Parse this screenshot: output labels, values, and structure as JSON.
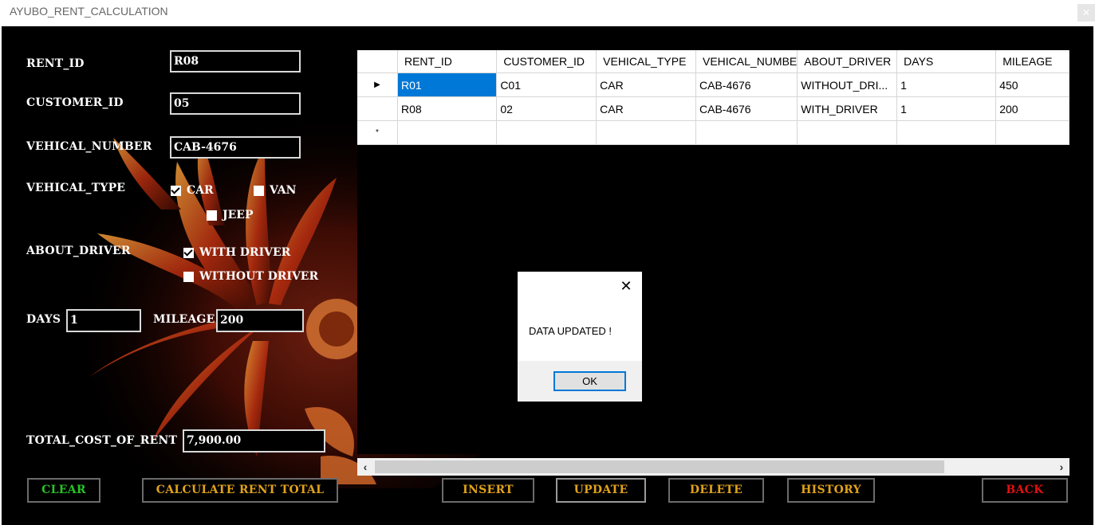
{
  "window": {
    "title": "AYUBO_RENT_CALCULATION"
  },
  "form": {
    "rent_id_label": "RENT_ID",
    "rent_id_value": "R08",
    "customer_id_label": "CUSTOMER_ID",
    "customer_id_value": "05",
    "vehical_number_label": "VEHICAL_NUMBER",
    "vehical_number_value": "CAB-4676",
    "vehical_type_label": "VEHICAL_TYPE",
    "vehical_types": [
      {
        "label": "CAR",
        "checked": true
      },
      {
        "label": "VAN",
        "checked": false
      },
      {
        "label": "JEEP",
        "checked": false
      }
    ],
    "about_driver_label": "ABOUT_DRIVER",
    "driver_options": [
      {
        "label": "WITH DRIVER",
        "checked": true
      },
      {
        "label": "WITHOUT DRIVER",
        "checked": false
      }
    ],
    "days_label": "DAYS",
    "days_value": "1",
    "mileage_label": "MILEAGE",
    "mileage_value": "200",
    "total_label": "TOTAL_COST_OF_RENT",
    "total_value": "7,900.00"
  },
  "grid": {
    "columns": [
      "RENT_ID",
      "CUSTOMER_ID",
      "VEHICAL_TYPE",
      "VEHICAL_NUMBE",
      "ABOUT_DRIVER",
      "DAYS",
      "MILEAGE"
    ],
    "rows": [
      [
        "R01",
        "C01",
        "CAR",
        "CAB-4676",
        "WITHOUT_DRI...",
        "1",
        "450"
      ],
      [
        "R08",
        "02",
        "CAR",
        "CAB-4676",
        "WITH_DRIVER",
        "1",
        "200"
      ]
    ],
    "current_row_marker": "▶",
    "new_row_marker": "*"
  },
  "dialog": {
    "message": "DATA UPDATED !",
    "ok_label": "OK"
  },
  "buttons": {
    "clear": "CLEAR",
    "calculate": "CALCULATE RENT TOTAL",
    "insert": "INSERT",
    "update": "UPDATE",
    "delete": "DELETE",
    "history": "HISTORY",
    "back": "BACK"
  },
  "colors": {
    "clear": "#27c427",
    "calculate": "#e0a21a",
    "action": "#e0a21a",
    "back": "#e01010"
  }
}
